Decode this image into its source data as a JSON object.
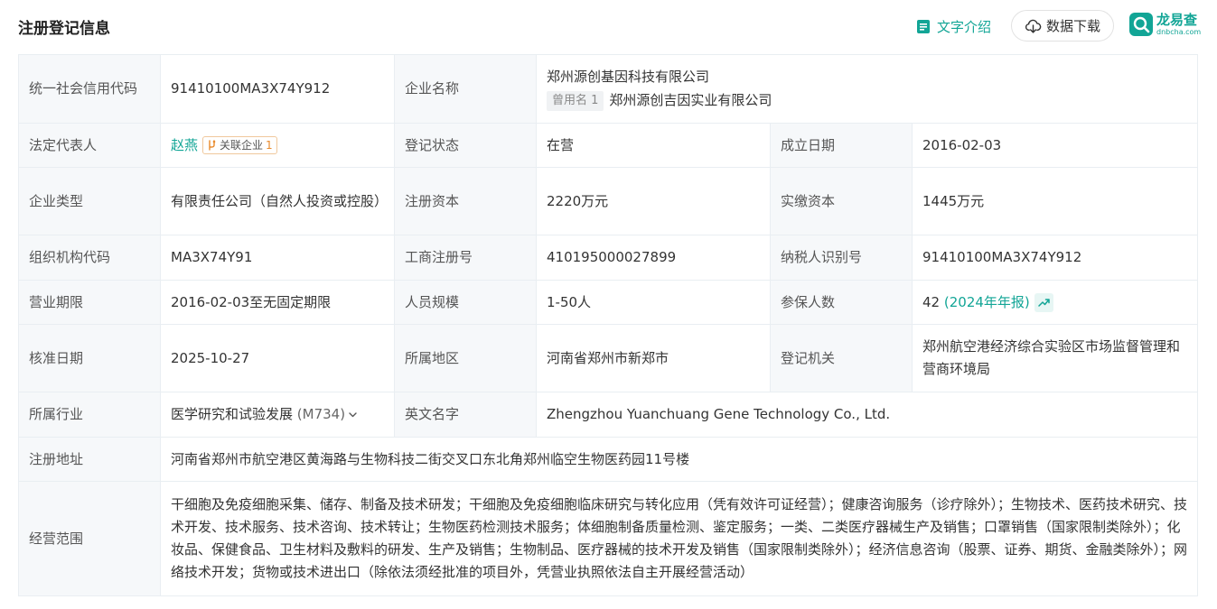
{
  "header": {
    "title": "注册登记信息",
    "text_intro_label": "文字介绍",
    "download_label": "数据下载",
    "brand_name": "龙易查",
    "brand_domain": "dnbcha.com"
  },
  "colors": {
    "accent": "#12a596",
    "label_bg": "#f6f8fa",
    "border": "#e9eef2",
    "tag_orange": "#e98a2c"
  },
  "icons": {
    "text_intro": "document-icon",
    "download": "cloud-download-icon",
    "logo": "longyicha-logo-icon",
    "related": "relation-icon",
    "trend": "trend-chart-icon",
    "expand": "chevron-down-icon"
  },
  "fields": {
    "credit_code": {
      "label": "统一社会信用代码",
      "value": "91410100MA3X74Y912"
    },
    "company_name": {
      "label": "企业名称",
      "value": "郑州源创基因科技有限公司",
      "former_tag": "曾用名 1",
      "former_value": "郑州源创吉因实业有限公司"
    },
    "legal_rep": {
      "label": "法定代表人",
      "value": "赵燕",
      "related_label": "关联企业",
      "related_count": "1"
    },
    "reg_status": {
      "label": "登记状态",
      "value": "在营"
    },
    "est_date": {
      "label": "成立日期",
      "value": "2016-02-03"
    },
    "company_type": {
      "label": "企业类型",
      "value": "有限责任公司（自然人投资或控股）"
    },
    "reg_capital": {
      "label": "注册资本",
      "value": "2220万元"
    },
    "paid_capital": {
      "label": "实缴资本",
      "value": "1445万元"
    },
    "org_code": {
      "label": "组织机构代码",
      "value": "MA3X74Y91"
    },
    "biz_reg_no": {
      "label": "工商注册号",
      "value": "410195000027899"
    },
    "taxpayer_id": {
      "label": "纳税人识别号",
      "value": "91410100MA3X74Y912"
    },
    "biz_term": {
      "label": "营业期限",
      "value": "2016-02-03至无固定期限"
    },
    "staff_size": {
      "label": "人员规模",
      "value": "1-50人"
    },
    "insured": {
      "label": "参保人数",
      "value": "42",
      "annual": "(2024年年报)"
    },
    "approval_date": {
      "label": "核准日期",
      "value": "2025-10-27"
    },
    "region": {
      "label": "所属地区",
      "value": "河南省郑州市新郑市"
    },
    "reg_authority": {
      "label": "登记机关",
      "value": "郑州航空港经济综合实验区市场监督管理和营商环境局"
    },
    "industry": {
      "label": "所属行业",
      "value": "医学研究和试验发展",
      "code": "(M734)"
    },
    "english_name": {
      "label": "英文名字",
      "value": "Zhengzhou Yuanchuang Gene Technology Co., Ltd."
    },
    "reg_address": {
      "label": "注册地址",
      "value": "河南省郑州市航空港区黄海路与生物科技二街交叉口东北角郑州临空生物医药园11号楼"
    },
    "biz_scope": {
      "label": "经营范围",
      "value": "干细胞及免疫细胞采集、储存、制备及技术研发；干细胞及免疫细胞临床研究与转化应用（凭有效许可证经营）；健康咨询服务（诊疗除外）；生物技术、医药技术研究、技术开发、技术服务、技术咨询、技术转让；生物医药检测技术服务；体细胞制备质量检测、鉴定服务；一类、二类医疗器械生产及销售；口罩销售（国家限制类除外）；化妆品、保健食品、卫生材料及敷料的研发、生产及销售；生物制品、医疗器械的技术开发及销售（国家限制类除外）；经济信息咨询（股票、证券、期货、金融类除外）；网络技术开发；货物或技术进出口（除依法须经批准的项目外，凭营业执照依法自主开展经营活动）"
    }
  }
}
